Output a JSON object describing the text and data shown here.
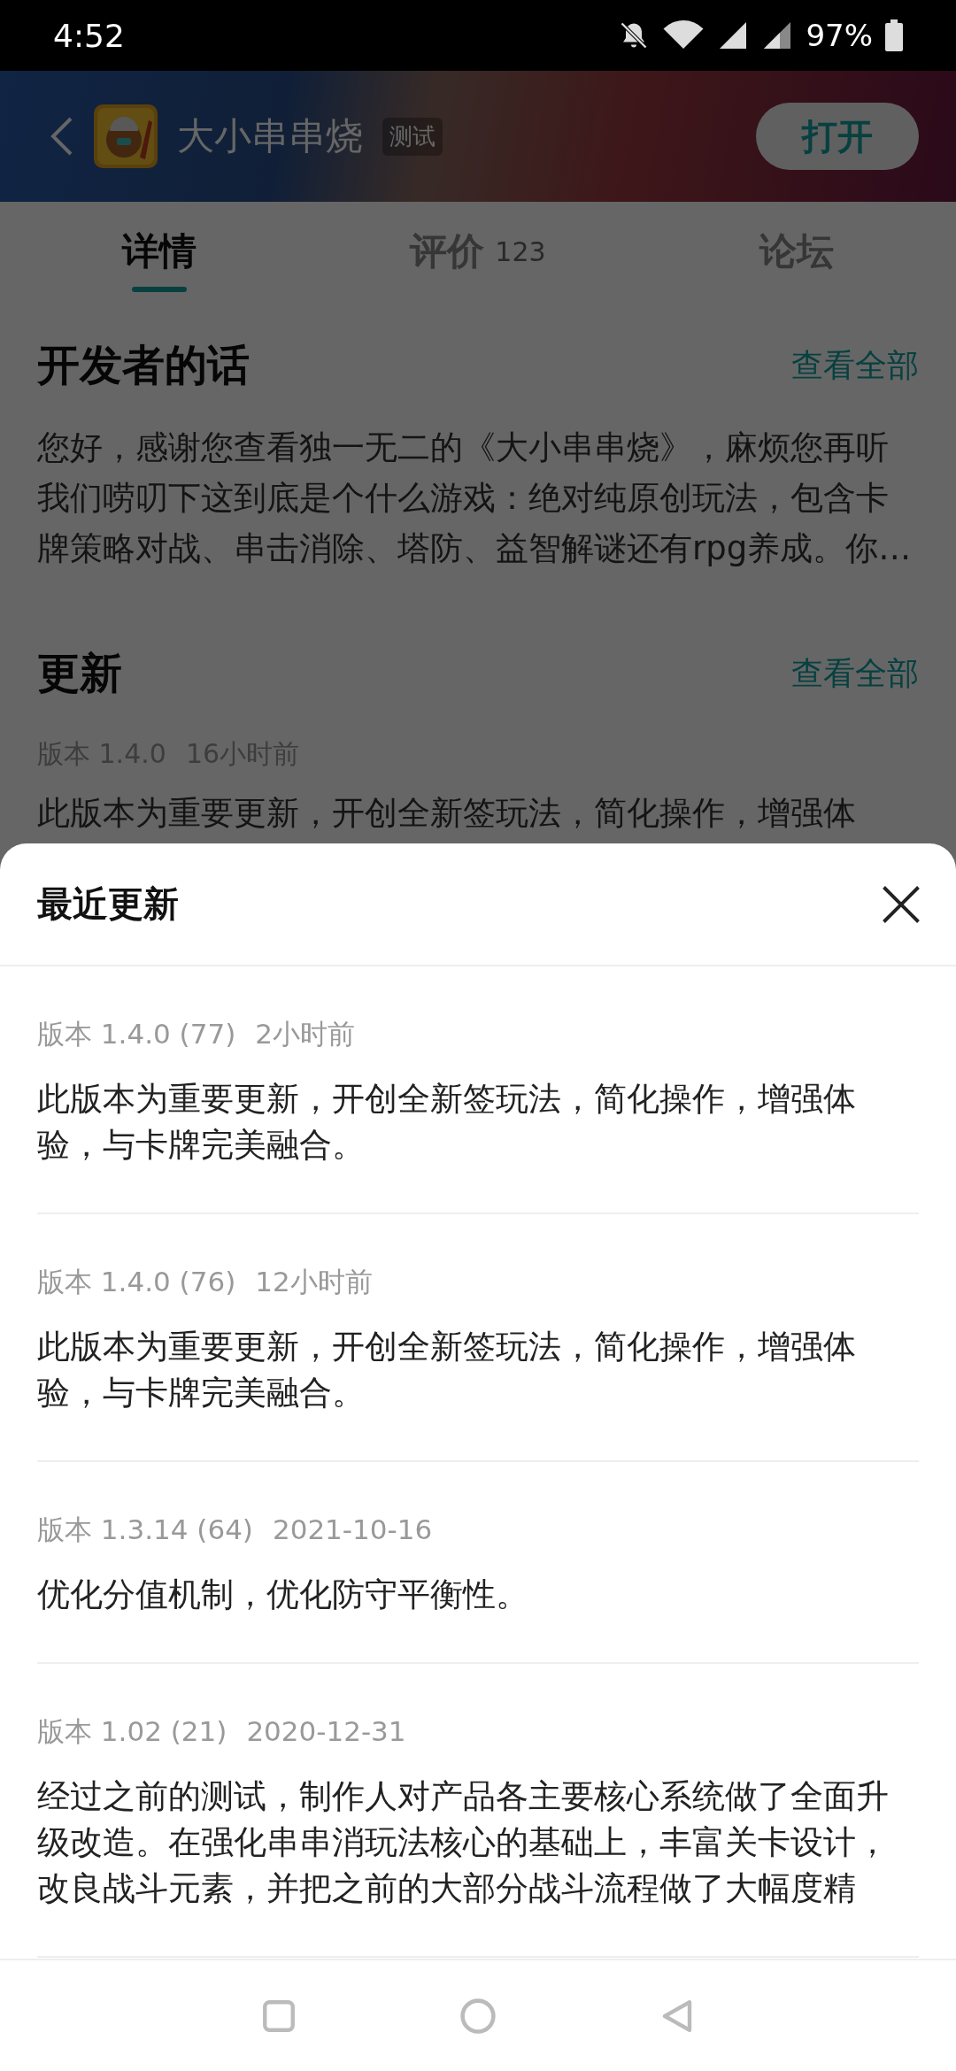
{
  "status_bar": {
    "time": "4:52",
    "battery": "97%"
  },
  "header": {
    "app_name": "大小串串烧",
    "badge": "测试",
    "open_button": "打开"
  },
  "tabs": [
    {
      "label": "详情",
      "selected": true
    },
    {
      "label": "评价",
      "count": "123",
      "selected": false
    },
    {
      "label": "论坛",
      "selected": false
    }
  ],
  "sections": [
    {
      "kind": "text",
      "title": "开发者的话",
      "link": "查看全部",
      "text": "您好，感谢您查看独一无二的《大小串串烧》，麻烦您再听我们唠叨下这到底是个什么游戏：绝对纯原创玩法，包含卡牌策略对战、串击消除、塔防、益智解谜还有rpg养成。你…"
    },
    {
      "kind": "update",
      "title": "更新",
      "link": "查看全部",
      "version": "版本 1.4.0",
      "time": "16小时前",
      "text": "此版本为重要更新，开创全新签玩法，简化操作，增强体"
    }
  ],
  "sheet": {
    "title": "最近更新",
    "updates": [
      {
        "version": "版本 1.4.0 (77)",
        "time": "2小时前",
        "text": "此版本为重要更新，开创全新签玩法，简化操作，增强体验，与卡牌完美融合。"
      },
      {
        "version": "版本 1.4.0 (76)",
        "time": "12小时前",
        "text": "此版本为重要更新，开创全新签玩法，简化操作，增强体验，与卡牌完美融合。"
      },
      {
        "version": "版本 1.3.14 (64)",
        "time": "2021-10-16",
        "text": "优化分值机制，优化防守平衡性。"
      },
      {
        "version": "版本 1.02 (21)",
        "time": "2020-12-31",
        "text": "经过之前的测试，制作人对产品各主要核心系统做了全面升级改造。在强化串串消玩法核心的基础上，丰富关卡设计，改良战斗元素，并把之前的大部分战斗流程做了大幅度精"
      }
    ]
  }
}
